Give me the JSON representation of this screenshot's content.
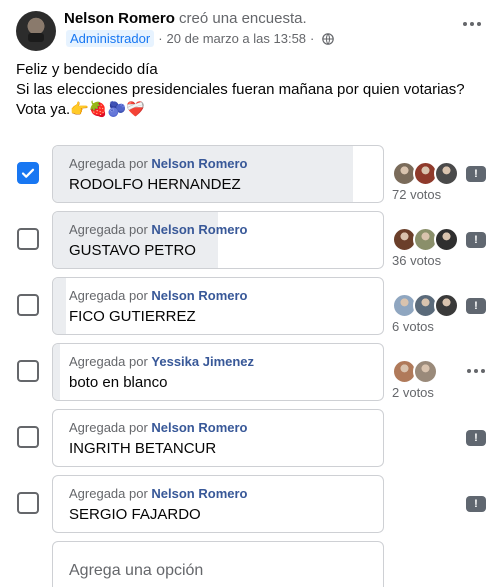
{
  "post": {
    "author": "Nelson Romero",
    "action": "creó una encuesta.",
    "role_badge": "Administrador",
    "timestamp": "20 de marzo a las 13:58",
    "privacy_icon": "globe-icon",
    "text_lines": [
      "Feliz y bendecido día",
      "Si las elecciones presidenciales fueran mañana por quien votarias?",
      "Vota ya.👉🍓🫐❤️‍🩹"
    ]
  },
  "poll": {
    "added_by_prefix": "Agregada por",
    "options": [
      {
        "added_by": "Nelson Romero",
        "name": "RODOLFO HERNANDEZ",
        "votes": "72 votos",
        "fill": 0.91,
        "checked": true,
        "voter_colors": [
          "#7a6b5a",
          "#8f3a2b",
          "#4a4a4a"
        ],
        "menu": "flag"
      },
      {
        "added_by": "Nelson Romero",
        "name": "GUSTAVO PETRO",
        "votes": "36 votos",
        "fill": 0.5,
        "checked": false,
        "voter_colors": [
          "#6b3f2a",
          "#8a8f6a",
          "#2f2f2f"
        ],
        "menu": "flag"
      },
      {
        "added_by": "Nelson Romero",
        "name": "FICO GUTIERREZ",
        "votes": "6 votos",
        "fill": 0.04,
        "checked": false,
        "voter_colors": [
          "#8fa6c0",
          "#5a6a7a",
          "#3a3a3a"
        ],
        "menu": "flag"
      },
      {
        "added_by": "Yessika Jimenez",
        "name": "boto en blanco",
        "votes": "2 votos",
        "fill": 0.02,
        "checked": false,
        "voter_colors": [
          "#b07a5a",
          "#9a8a7a"
        ],
        "menu": "more"
      },
      {
        "added_by": "Nelson Romero",
        "name": "INGRITH BETANCUR",
        "votes": "",
        "fill": 0,
        "checked": false,
        "voter_colors": [],
        "menu": "flag"
      },
      {
        "added_by": "Nelson Romero",
        "name": "SERGIO FAJARDO",
        "votes": "",
        "fill": 0,
        "checked": false,
        "voter_colors": [],
        "menu": "flag"
      }
    ],
    "add_option_placeholder": "Agrega una opción"
  },
  "colors": {
    "accent": "#1877f2",
    "link": "#385898",
    "muted": "#65676b"
  }
}
